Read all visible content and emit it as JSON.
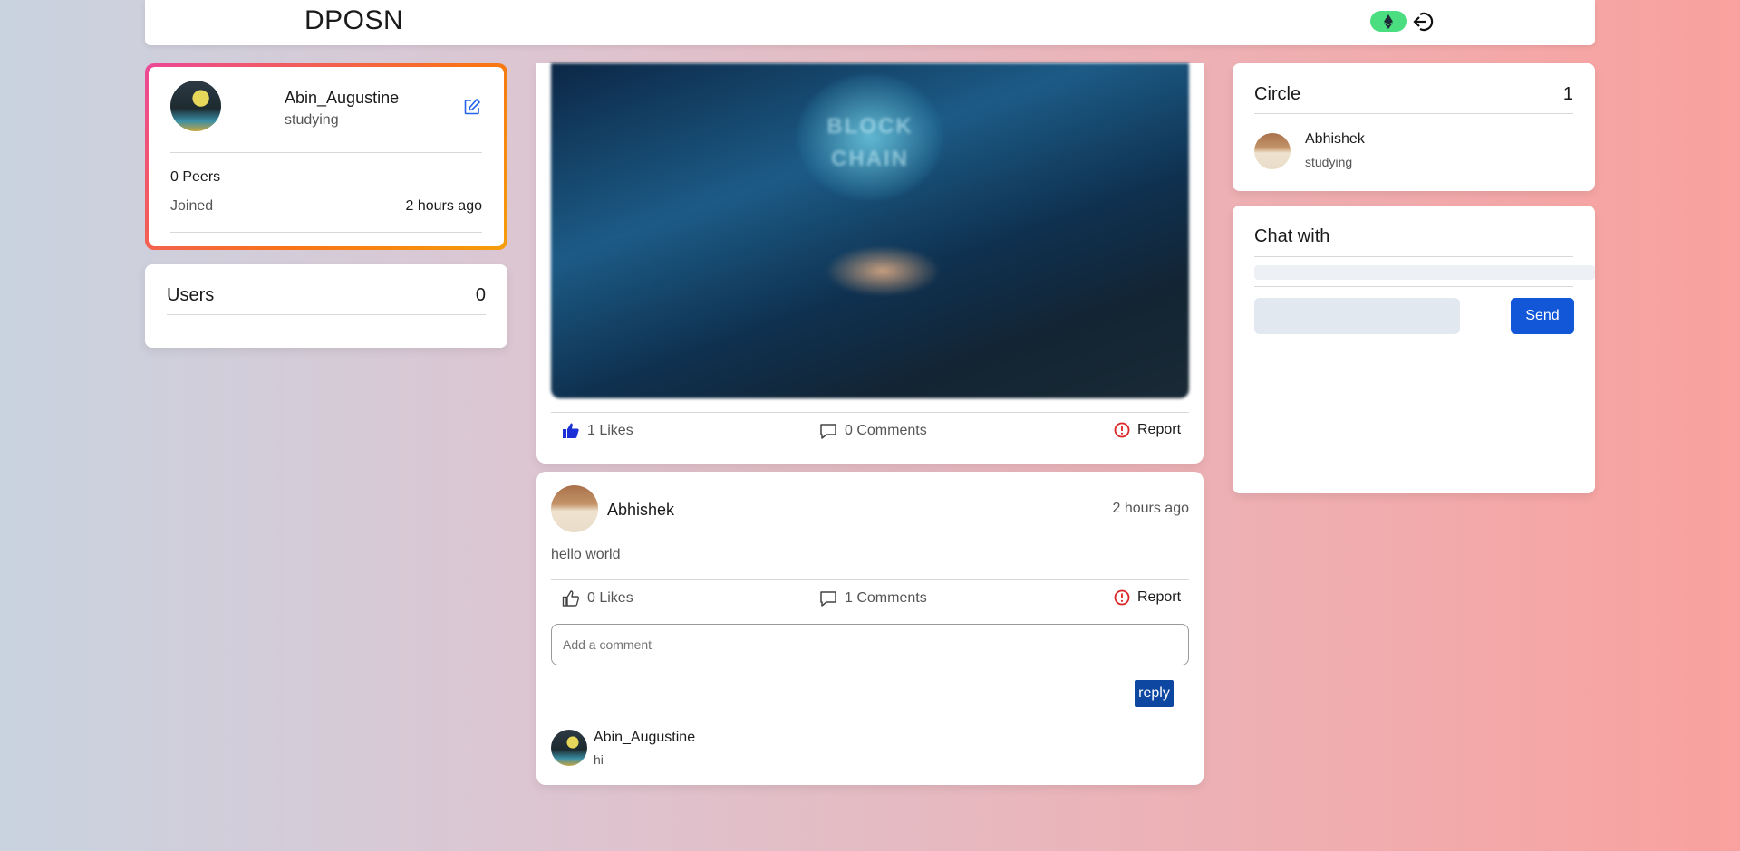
{
  "navbar": {
    "brand": "DPOSN",
    "wallet_icon": "ethereum-icon",
    "logout_icon": "logout-icon"
  },
  "profile": {
    "name": "Abin_Augustine",
    "status": "studying",
    "peers": "0 Peers",
    "joined_label": "Joined",
    "joined_value": "2 hours ago"
  },
  "users_card": {
    "title": "Users",
    "count": "0"
  },
  "posts": [
    {
      "image_text": "BLOCK CHAIN",
      "likes": "1 Likes",
      "comments": "0 Comments",
      "report": "Report"
    },
    {
      "author": "Abhishek",
      "time": "2 hours ago",
      "text": "hello world",
      "likes": "0 Likes",
      "comments": "1 Comments",
      "report": "Report",
      "comment_placeholder": "Add a comment",
      "reply_label": "reply",
      "comment_list": [
        {
          "author": "Abin_Augustine",
          "text": "hi"
        }
      ]
    }
  ],
  "circle": {
    "title": "Circle",
    "count": "1",
    "members": [
      {
        "name": "Abhishek",
        "status": "studying"
      }
    ]
  },
  "chat": {
    "title": "Chat with",
    "send_label": "Send"
  },
  "colors": {
    "like_active": "#1a2fd6",
    "report": "#dc2626",
    "send": "#1157d8",
    "reply": "#0d47a1",
    "eth_pill": "#4ade80"
  }
}
